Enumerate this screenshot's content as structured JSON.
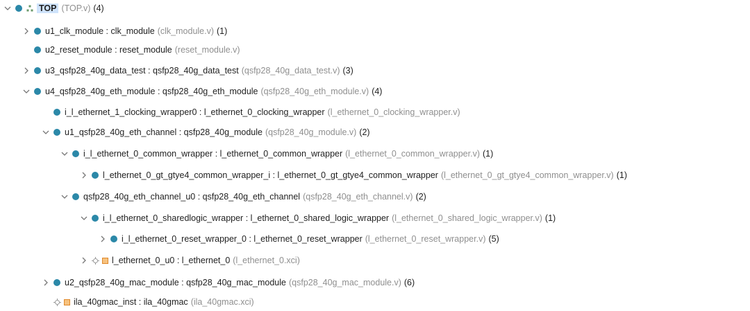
{
  "rows": [
    {
      "name": "TOP",
      "file": "(TOP.v)",
      "count": "(4)"
    },
    {
      "name": "u1_clk_module : clk_module",
      "file": "(clk_module.v)",
      "count": "(1)"
    },
    {
      "name": "u2_reset_module : reset_module",
      "file": "(reset_module.v)",
      "count": ""
    },
    {
      "name": "u3_qsfp28_40g_data_test : qsfp28_40g_data_test",
      "file": "(qsfp28_40g_data_test.v)",
      "count": "(3)"
    },
    {
      "name": "u4_qsfp28_40g_eth_module : qsfp28_40g_eth_module",
      "file": "(qsfp28_40g_eth_module.v)",
      "count": "(4)"
    },
    {
      "name": "i_l_ethernet_1_clocking_wrapper0 : l_ethernet_0_clocking_wrapper",
      "file": "(l_ethernet_0_clocking_wrapper.v)",
      "count": ""
    },
    {
      "name": "u1_qsfp28_40g_eth_channel : qsfp28_40g_module",
      "file": "(qsfp28_40g_module.v)",
      "count": "(2)"
    },
    {
      "name": "i_l_ethernet_0_common_wrapper : l_ethernet_0_common_wrapper",
      "file": "(l_ethernet_0_common_wrapper.v)",
      "count": "(1)"
    },
    {
      "name": "l_ethernet_0_gt_gtye4_common_wrapper_i : l_ethernet_0_gt_gtye4_common_wrapper",
      "file": "(l_ethernet_0_gt_gtye4_common_wrapper.v)",
      "count": "(1)"
    },
    {
      "name": "qsfp28_40g_eth_channel_u0 : qsfp28_40g_eth_channel",
      "file": "(qsfp28_40g_eth_channel.v)",
      "count": "(2)"
    },
    {
      "name": "i_l_ethernet_0_sharedlogic_wrapper : l_ethernet_0_shared_logic_wrapper",
      "file": "(l_ethernet_0_shared_logic_wrapper.v)",
      "count": "(1)"
    },
    {
      "name": "i_l_ethernet_0_reset_wrapper_0 : l_ethernet_0_reset_wrapper",
      "file": "(l_ethernet_0_reset_wrapper.v)",
      "count": "(5)"
    },
    {
      "name": "l_ethernet_0_u0 : l_ethernet_0",
      "file": "(l_ethernet_0.xci)",
      "count": ""
    },
    {
      "name": "u2_qsfp28_40g_mac_module : qsfp28_40g_mac_module",
      "file": "(qsfp28_40g_mac_module.v)",
      "count": "(6)"
    },
    {
      "name": "ila_40gmac_inst : ila_40gmac",
      "file": "(ila_40gmac.xci)",
      "count": ""
    }
  ],
  "colors": {
    "module_dot": "#2b88a8",
    "file_text": "#8f8f8f",
    "selected_bg": "#cfe3fb",
    "ip_square": "#f6c27f"
  },
  "icons": {
    "expanded": "chevron-down-icon",
    "collapsed": "chevron-right-icon",
    "module": "module-dot-icon",
    "hierarchy": "hierarchy-icon",
    "ip": "ip-core-icon"
  }
}
